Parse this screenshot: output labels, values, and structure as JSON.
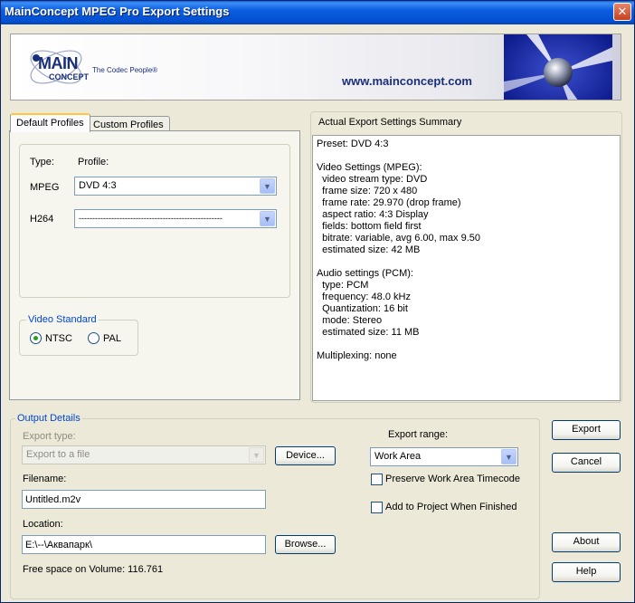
{
  "window": {
    "title": "MainConcept MPEG Pro Export Settings",
    "close_glyph": "✕"
  },
  "banner": {
    "logo_main": "MAIN",
    "logo_concept": "CONCEPT",
    "logo_tagline": "The Codec People®",
    "url": "www.mainconcept.com"
  },
  "tabs": [
    {
      "label": "Default Profiles",
      "active": true
    },
    {
      "label": "Custom Profiles",
      "active": false
    }
  ],
  "profiles": {
    "type_header": "Type:",
    "profile_header": "Profile:",
    "rows": [
      {
        "type": "MPEG",
        "value": "DVD 4:3"
      },
      {
        "type": "H264",
        "value": "-----------------------------------------------------"
      }
    ]
  },
  "video_standard": {
    "label": "Video Standard",
    "options": [
      {
        "label": "NTSC",
        "checked": true
      },
      {
        "label": "PAL",
        "checked": false
      }
    ]
  },
  "summary": {
    "header": "Actual Export Settings Summary",
    "lines": [
      "Preset: DVD 4:3",
      "",
      "Video Settings (MPEG):",
      "  video stream type: DVD",
      "  frame size: 720 x 480",
      "  frame rate: 29.970 (drop frame)",
      "  aspect ratio: 4:3 Display",
      "  fields: bottom field first",
      "  bitrate: variable, avg 6.00, max 9.50",
      "  estimated size: 42 MB",
      "",
      "Audio settings (PCM):",
      "  type: PCM",
      "  frequency: 48.0 kHz",
      "  Quantization: 16 bit",
      "  mode: Stereo",
      "  estimated size: 11 MB",
      "",
      "Multiplexing: none"
    ]
  },
  "output": {
    "group_label": "Output Details",
    "export_type_label": "Export type:",
    "export_type_value": "Export to a file",
    "device_button": "Device...",
    "filename_label": "Filename:",
    "filename_value": "Untitled.m2v",
    "location_label": "Location:",
    "location_value": "E:\\--\\Аквапарк\\",
    "browse_button": "Browse...",
    "free_space": "Free space on Volume: 116.761",
    "export_range_label": "Export range:",
    "export_range_value": "Work Area",
    "preserve_timecode_label": "Preserve Work Area Timecode",
    "preserve_timecode_checked": false,
    "add_to_project_label": "Add to Project When Finished",
    "add_to_project_checked": false
  },
  "buttons": {
    "export": "Export",
    "cancel": "Cancel",
    "about": "About",
    "help": "Help"
  }
}
